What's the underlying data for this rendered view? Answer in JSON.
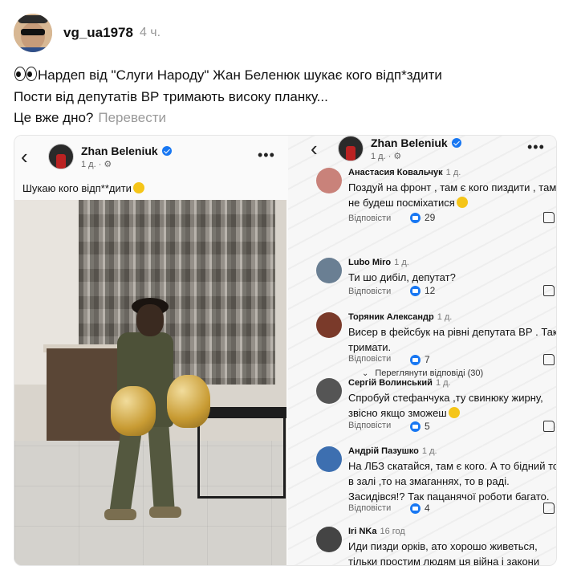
{
  "post": {
    "username": "vg_ua1978",
    "time": "4 ч.",
    "lines": [
      "Нардеп від \"Слуги Народу\" Жан Беленюк шукає кого відп*здити",
      "Пости від депутатів ВР тримають високу планку...",
      "Це вже дно?"
    ],
    "translate": "Перевести",
    "lead_emoji": "eyes-emoji"
  },
  "left_panel": {
    "author": "Zhan Beleniuk",
    "meta": "1 д. · ⚙",
    "text": "Шукаю кого відп**дити",
    "more": "•••"
  },
  "right_panel": {
    "author": "Zhan Beleniuk",
    "meta": "1 д. · ⚙",
    "more": "•••",
    "show_more_replies": "Переглянути відповіді (30)",
    "reply_label": "Відповісти",
    "comments": [
      {
        "name": "Анастасия Ковальчук",
        "time": "1 д.",
        "lines": [
          "Поздуй на фронт , там є кого пиздити , там",
          "не будеш посміхатися"
        ],
        "likes": "29",
        "avatar_color": "#c9827a"
      },
      {
        "name": "Lubo Miro",
        "time": "1 д.",
        "lines": [
          "Ти шо дибіл, депутат?"
        ],
        "likes": "12",
        "avatar_color": "#6a7f93"
      },
      {
        "name": "Торяник Александр",
        "time": "1 д.",
        "lines": [
          "Висер в фейсбук на рівні  депутата ВР . Так",
          "тримати."
        ],
        "likes": "7",
        "avatar_color": "#7a3a2a"
      },
      {
        "name": "Сергій Волинський",
        "time": "1 д.",
        "lines": [
          "Спробуй стефанчука ,ту свинюку жирну,",
          "звісно якщо зможеш"
        ],
        "likes": "5",
        "avatar_color": "#555555"
      },
      {
        "name": "Андрій Пазушко",
        "time": "1 д.",
        "lines": [
          "На ЛБЗ скатайся, там є кого. А то бідний то",
          "в залі ,то на змаганнях, то в раді.",
          "Засидівся!?  Так пацанячої роботи багато."
        ],
        "likes": "4",
        "avatar_color": "#3d6fb0"
      },
      {
        "name": "Iri  NKa",
        "time": "16 год",
        "lines": [
          "Иди пизди орків, ато хорошо живеться,",
          "тільки простим людям ця війна і закони"
        ],
        "likes": "",
        "avatar_color": "#444444"
      }
    ]
  }
}
